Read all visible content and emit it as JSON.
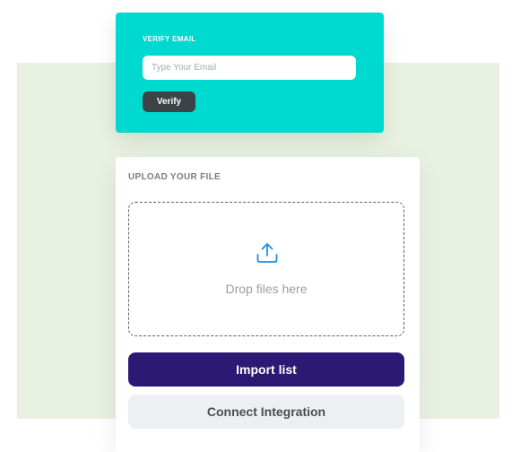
{
  "verify_email": {
    "title": "VERIFY EMAIL",
    "input_placeholder": "Type Your Email",
    "input_value": "",
    "button_label": "Verify"
  },
  "upload": {
    "title": "UPLOAD YOUR FILE",
    "dropzone_text": "Drop files here",
    "dropzone_icon": "upload-icon",
    "import_button_label": "Import list",
    "connect_button_label": "Connect Integration"
  },
  "colors": {
    "accent_teal": "#00d9cf",
    "primary_purple": "#2a1a74",
    "icon_blue": "#1e8ee6",
    "background_green": "#e8f1e2"
  }
}
